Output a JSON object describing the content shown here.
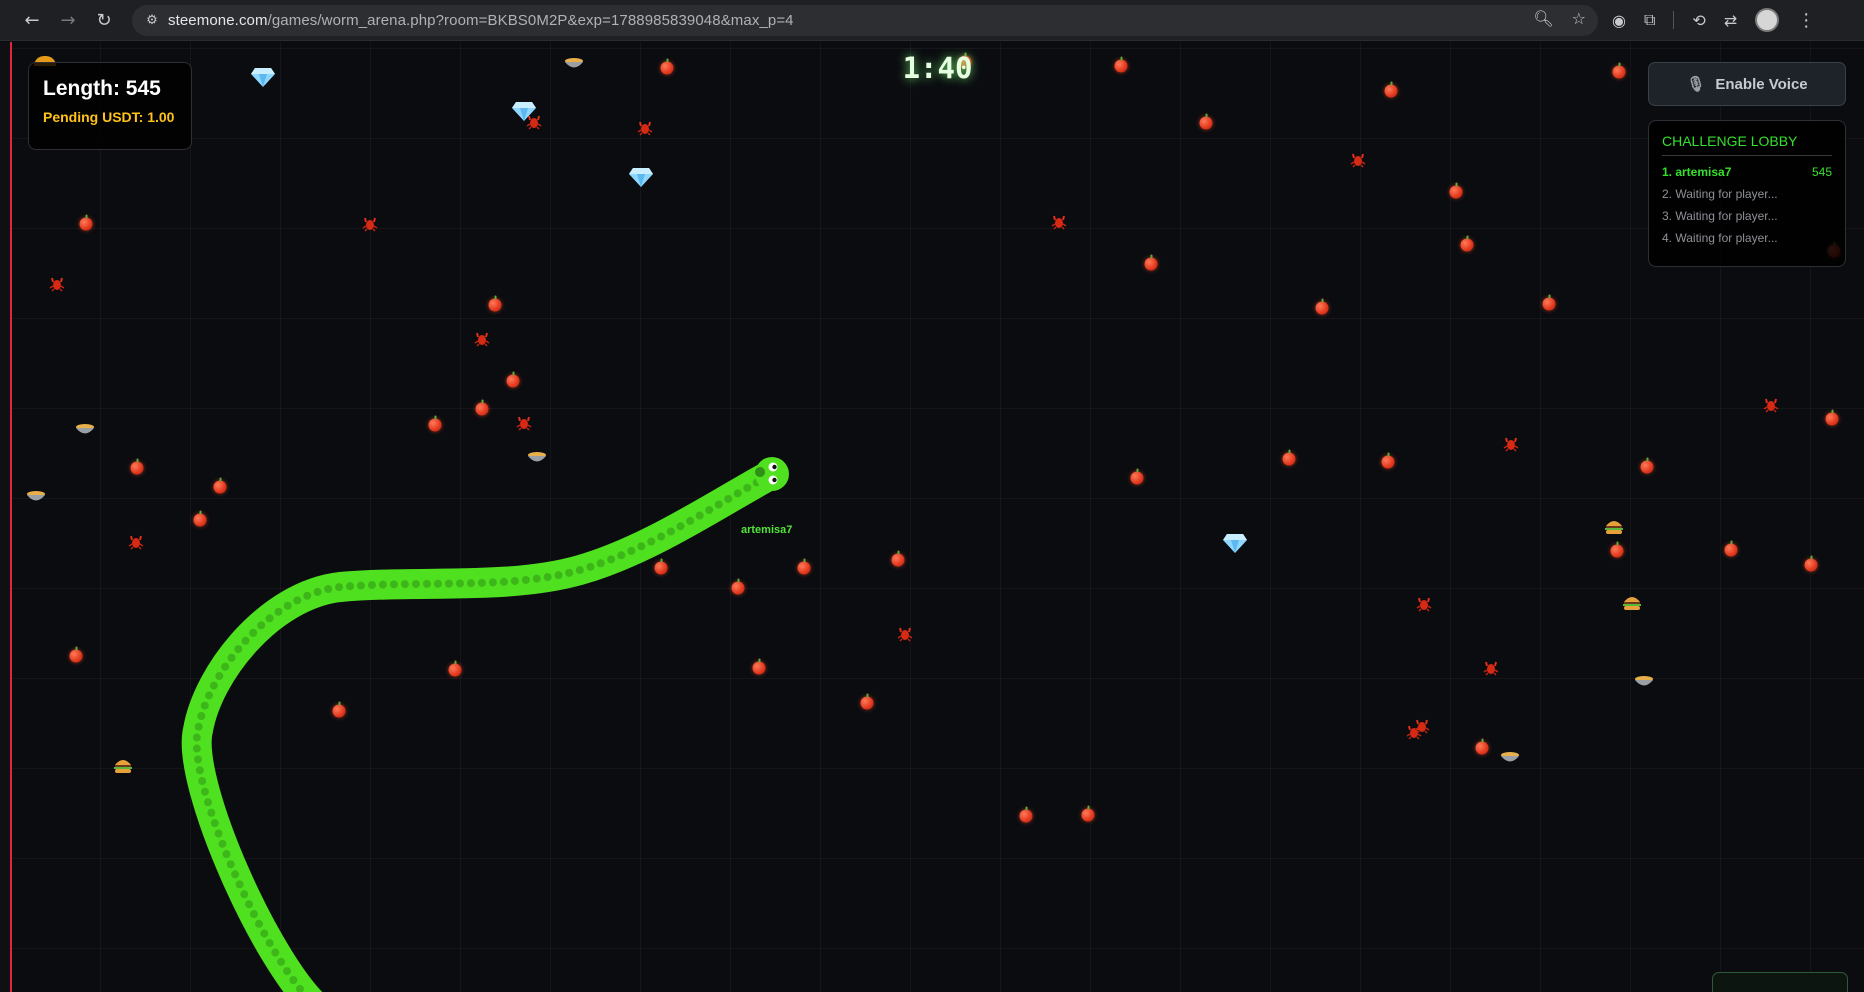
{
  "browser": {
    "url_host": "steemone.com",
    "url_path": "/games/worm_arena.php?room=BKBS0M2P&exp=1788985839048&max_p=4",
    "icons": [
      "back-icon",
      "forward-icon",
      "reload-icon",
      "site-settings-icon",
      "zoom-icon",
      "bookmark-star-icon",
      "extension-icon",
      "puzzle-extensions-icon",
      "history-icon",
      "translate-icon",
      "profile-avatar",
      "menu-kebab-icon"
    ]
  },
  "hud": {
    "length_text": "Length: 545",
    "pending_text": "Pending USDT: 1.00",
    "timer": "1:40"
  },
  "voice": {
    "label": "Enable Voice",
    "icon": "microphone-off-icon"
  },
  "lobby": {
    "title": "CHALLENGE LOBBY",
    "players": [
      {
        "label": "1. artemisa7",
        "score": "545"
      },
      {
        "label": "2. Waiting for player...",
        "score": ""
      },
      {
        "label": "3. Waiting for player...",
        "score": ""
      },
      {
        "label": "4. Waiting for player...",
        "score": ""
      }
    ]
  },
  "player": {
    "name": "artemisa7",
    "color": "#4fe01f"
  },
  "colors": {
    "accent_green": "#35e02a",
    "pending_yellow": "#ffc21a",
    "boundary_red": "#e0263b",
    "background": "#0b0c10"
  },
  "collectible_types": [
    "food-pellet",
    "crab-icon",
    "gem-icon",
    "bowl-icon",
    "burger-icon"
  ]
}
